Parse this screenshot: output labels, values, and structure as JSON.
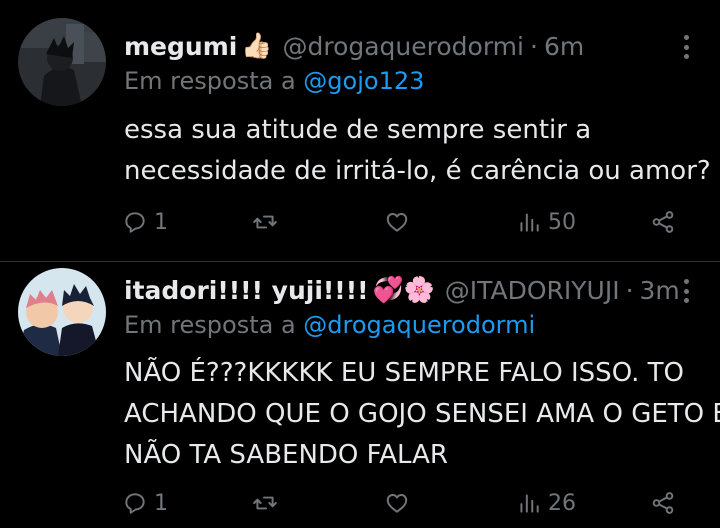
{
  "tweets": [
    {
      "name": "megumi",
      "emoji": "👍🏻",
      "handle": "@drogaquerodormi",
      "dot": "·",
      "time": "6m",
      "reply_prefix": "Em resposta a",
      "reply_to": "@gojo123",
      "text_lines": [
        "essa sua atitude de sempre sentir a",
        "necessidade de irritá-lo, é carência ou amor?"
      ],
      "replies": "1",
      "retweets": "",
      "likes": "",
      "views": "50"
    },
    {
      "name": "itadori!!!! yuji!!!!",
      "emoji": "💞🌸",
      "handle": "@ITADORIYUJI",
      "dot": "·",
      "time": "3m",
      "reply_prefix": "Em resposta a",
      "reply_to": "@drogaquerodormi",
      "text_lines": [
        "NÃO É???KKKKK EU SEMPRE FALO ISSO. TO",
        "ACHANDO QUE O GOJO SENSEI AMA O GETO E",
        "NÃO TA SABENDO FALAR"
      ],
      "replies": "1",
      "retweets": "",
      "likes": "",
      "views": "26"
    }
  ],
  "colors": {
    "background": "#000000",
    "text": "#e7e9ea",
    "secondary": "#71767b",
    "link": "#1d9bf0",
    "divider": "#2f3336"
  },
  "icons": {
    "reply": "reply-bubble-icon",
    "retweet": "retweet-icon",
    "like": "heart-icon",
    "views": "views-bar-chart-icon",
    "share": "share-icon",
    "more": "more-vertical-icon"
  }
}
